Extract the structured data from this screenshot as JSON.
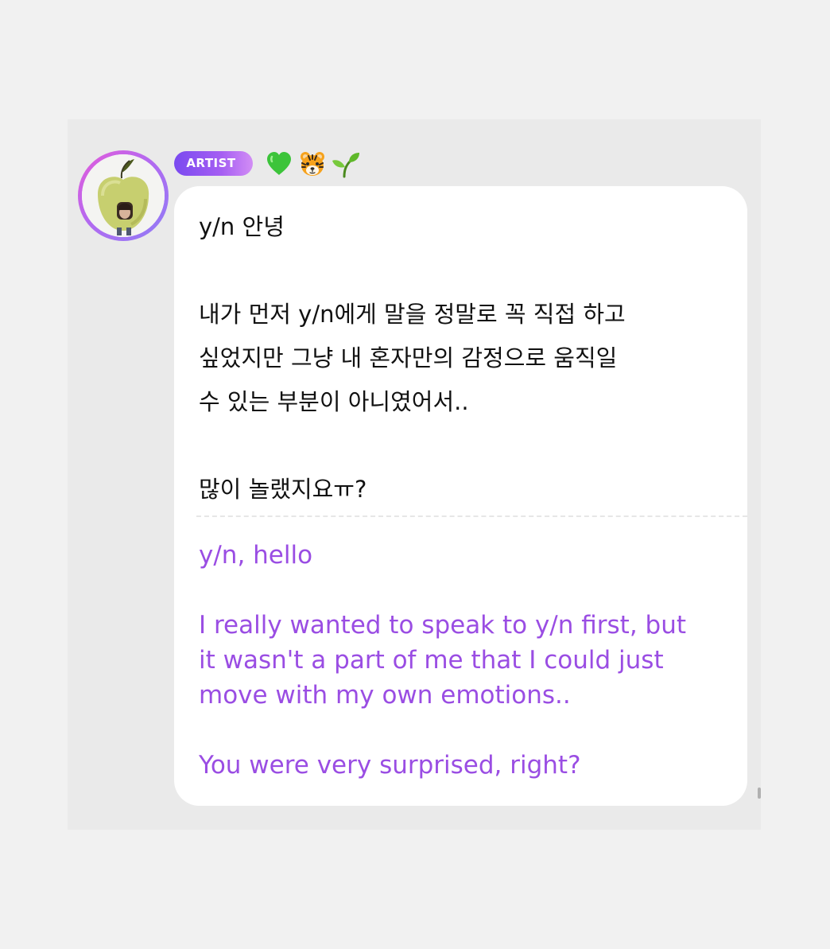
{
  "badge": {
    "label": "ARTIST"
  },
  "emojis": [
    "green-heart",
    "tiger-face",
    "seedling"
  ],
  "message": {
    "original": {
      "greeting": "y/n 안녕",
      "body_lines": [
        "내가 먼저 y/n에게 말을 정말로 꼭 직접 하고",
        "싶었지만 그냥 내 혼자만의 감정으로 움직일",
        "수 있는 부분이 아니였어서.."
      ],
      "closing": "많이 놀랬지요ㅠ?"
    },
    "translation": {
      "greeting": "y/n, hello",
      "body_lines": [
        "I really wanted to speak to y/n first, but",
        "it wasn't a part of me that I could just",
        "move with my own emotions.."
      ],
      "closing": "You were very surprised, right?"
    }
  },
  "colors": {
    "page_background": "#f1f1f1",
    "panel_background": "#eaeaea",
    "bubble_background": "#ffffff",
    "translation_text": "#9a4de3",
    "original_text": "#111111",
    "badge_gradient_start": "#7a4af0",
    "badge_gradient_end": "#d28df5"
  }
}
